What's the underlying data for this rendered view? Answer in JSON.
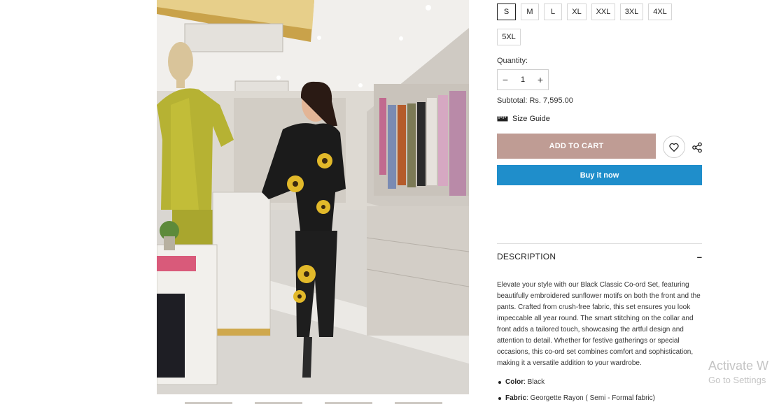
{
  "sizes": {
    "options": [
      "S",
      "M",
      "L",
      "XL",
      "XXL",
      "3XL",
      "4XL",
      "5XL"
    ],
    "selected": "S"
  },
  "quantity": {
    "label": "Quantity:",
    "value": "1",
    "minus": "−",
    "plus": "+"
  },
  "subtotal": "Subtotal: Rs. 7,595.00",
  "size_guide": {
    "label": "Size Guide",
    "icon": "ruler-icon"
  },
  "actions": {
    "add_to_cart": "ADD TO CART",
    "buy_now": "Buy it now",
    "wishlist_icon": "heart-icon",
    "share_icon": "share-icon"
  },
  "description": {
    "title": "DESCRIPTION",
    "toggle": "–",
    "text": "Elevate your style with our Black Classic Co-ord Set, featuring beautifully embroidered sunflower motifs on both the front and the pants. Crafted from crush-free fabric, this set ensures you look impeccable all year round. The smart stitching on the collar and front adds a tailored touch, showcasing the artful design and attention to detail. Whether for festive gatherings or special occasions, this co-ord set combines comfort and sophistication, making it a versatile addition to your wardrobe."
  },
  "specs": [
    {
      "key": "Color",
      "value": ": Black"
    },
    {
      "key": "Fabric",
      "value": ": Georgette Rayon ( Semi - Formal fabric)"
    }
  ],
  "watermark": {
    "line1": "Activate W",
    "line2": "Go to Settings"
  },
  "colors": {
    "add_to_cart_bg": "#bf9c94",
    "buy_now_bg": "#1f8ecb"
  }
}
